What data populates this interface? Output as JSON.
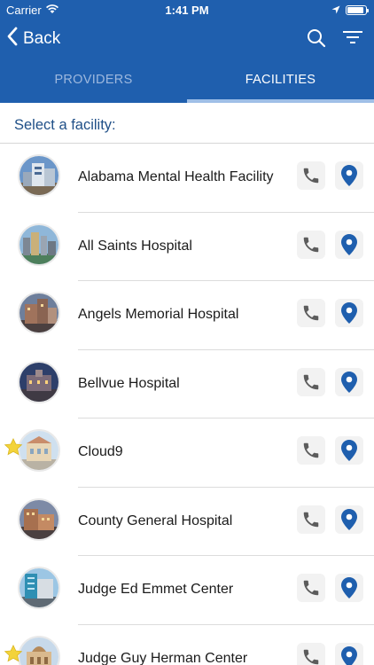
{
  "status": {
    "carrier": "Carrier",
    "time": "1:41 PM",
    "battery_level": 0.9
  },
  "nav": {
    "back_label": "Back"
  },
  "tabs": [
    {
      "label": "PROVIDERS",
      "active": false
    },
    {
      "label": "FACILITIES",
      "active": true
    }
  ],
  "subheader": "Select a facility:",
  "colors": {
    "brand": "#1f5fae",
    "pin": "#1f5fae",
    "star": "#f3d33a"
  },
  "facilities": [
    {
      "name": "Alabama Mental Health Facility",
      "favorite": false
    },
    {
      "name": "All Saints Hospital",
      "favorite": false
    },
    {
      "name": "Angels Memorial Hospital",
      "favorite": false
    },
    {
      "name": "Bellvue Hospital",
      "favorite": false
    },
    {
      "name": "Cloud9",
      "favorite": true
    },
    {
      "name": "County General Hospital",
      "favorite": false
    },
    {
      "name": "Judge Ed Emmet Center",
      "favorite": false
    },
    {
      "name": "Judge Guy Herman Center",
      "favorite": true
    }
  ]
}
